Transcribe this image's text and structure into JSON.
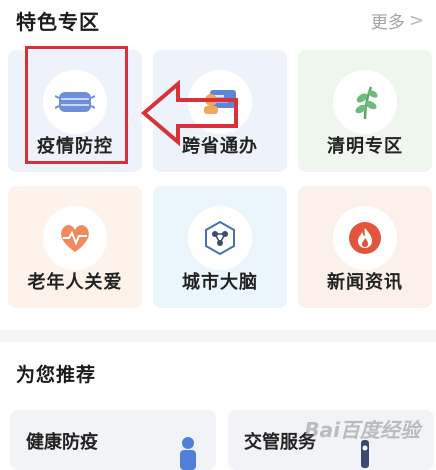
{
  "header": {
    "title": "特色专区",
    "more_label": "更多",
    "more_chevron": ">"
  },
  "grid": {
    "items": [
      {
        "label": "疫情防控",
        "icon": "mask-icon"
      },
      {
        "label": "跨省通办",
        "icon": "id-card-icon"
      },
      {
        "label": "清明专区",
        "icon": "leaf-icon"
      },
      {
        "label": "老年人关爱",
        "icon": "heart-pulse-icon"
      },
      {
        "label": "城市大脑",
        "icon": "brain-chip-icon"
      },
      {
        "label": "新闻资讯",
        "icon": "flame-icon"
      }
    ]
  },
  "recommend": {
    "title": "为您推荐",
    "items": [
      {
        "label": "健康防疫"
      },
      {
        "label": "交管服务"
      }
    ]
  },
  "watermark": "Bai百度经验",
  "colors": {
    "highlight": "#d8313a",
    "card_blue": "#eef3fb",
    "card_green": "#eef6ee",
    "card_orange": "#fdf3ea",
    "card_cyan": "#eaf6fb",
    "card_red": "#fbf0ea"
  }
}
